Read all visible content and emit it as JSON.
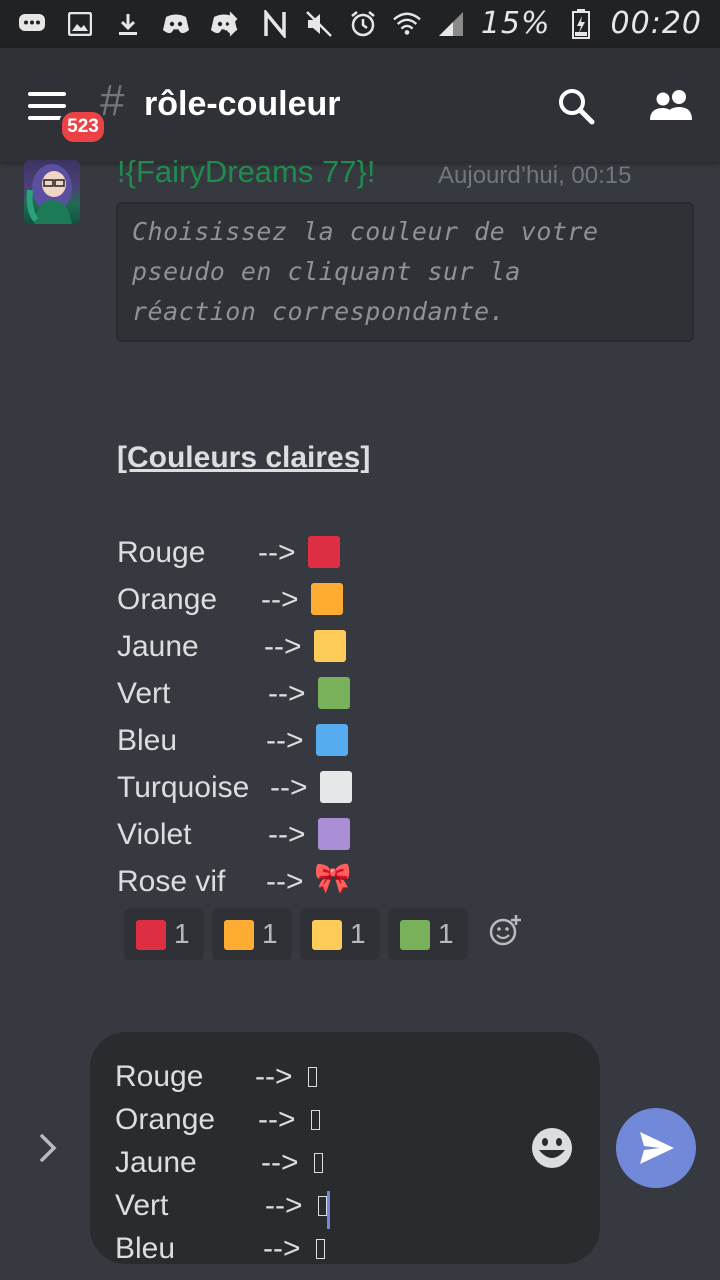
{
  "status_bar": {
    "battery": "15%",
    "time": "00:20",
    "left_icons": [
      "chat-icon",
      "image-icon",
      "download-icon",
      "discord-icon",
      "discord-icon"
    ],
    "right_icons": [
      "bluetooth-icon",
      "nfc-icon",
      "mute-icon",
      "alarm-icon",
      "wifi-icon",
      "signal-icon",
      "battery-icon"
    ]
  },
  "app_bar": {
    "notification_count": "523",
    "hash": "#",
    "channel_name": "rôle-couleur"
  },
  "message": {
    "author": "!{FairyDreams 77}!",
    "author_color": "#1f8b4c",
    "timestamp": "Aujourd’hui, 00:15",
    "code_text": "Choisissez la couleur de votre\npseudo en cliquant sur la\nréaction correspondante.",
    "section_title": "[Couleurs claires]",
    "colors": [
      {
        "name": "Rouge",
        "arrow": "-->",
        "swatch": "#dd2e44",
        "emoji": ""
      },
      {
        "name": "Orange",
        "arrow": "-->",
        "swatch": "#ffac33",
        "emoji": ""
      },
      {
        "name": "Jaune",
        "arrow": "-->",
        "swatch": "#fdcb58",
        "emoji": ""
      },
      {
        "name": "Vert",
        "arrow": "-->",
        "swatch": "#78b159",
        "emoji": ""
      },
      {
        "name": "Bleu",
        "arrow": "-->",
        "swatch": "#55acee",
        "emoji": ""
      },
      {
        "name": "Turquoise",
        "arrow": "-->",
        "swatch": "#e6e7e8",
        "emoji": ""
      },
      {
        "name": "Violet",
        "arrow": "-->",
        "swatch": "#aa8ed6",
        "emoji": ""
      },
      {
        "name": "Rose vif",
        "arrow": "-->",
        "swatch": "",
        "emoji": "🎀"
      }
    ],
    "reactions": [
      {
        "swatch": "#dd2e44",
        "count": "1"
      },
      {
        "swatch": "#ffac33",
        "count": "1"
      },
      {
        "swatch": "#fdcb58",
        "count": "1"
      },
      {
        "swatch": "#78b159",
        "count": "1"
      }
    ]
  },
  "composer": {
    "lines": [
      {
        "name": "Rouge",
        "arrow": "-->"
      },
      {
        "name": "Orange",
        "arrow": "-->"
      },
      {
        "name": "Jaune",
        "arrow": "-->"
      },
      {
        "name": "Vert",
        "arrow": "-->"
      },
      {
        "name": "Bleu",
        "arrow": "-->"
      }
    ]
  },
  "colors": {
    "background": "#36393f",
    "app_bar": "#2f3136",
    "status_bar": "#202225",
    "badge": "#ed4245",
    "blurple": "#7289da"
  }
}
